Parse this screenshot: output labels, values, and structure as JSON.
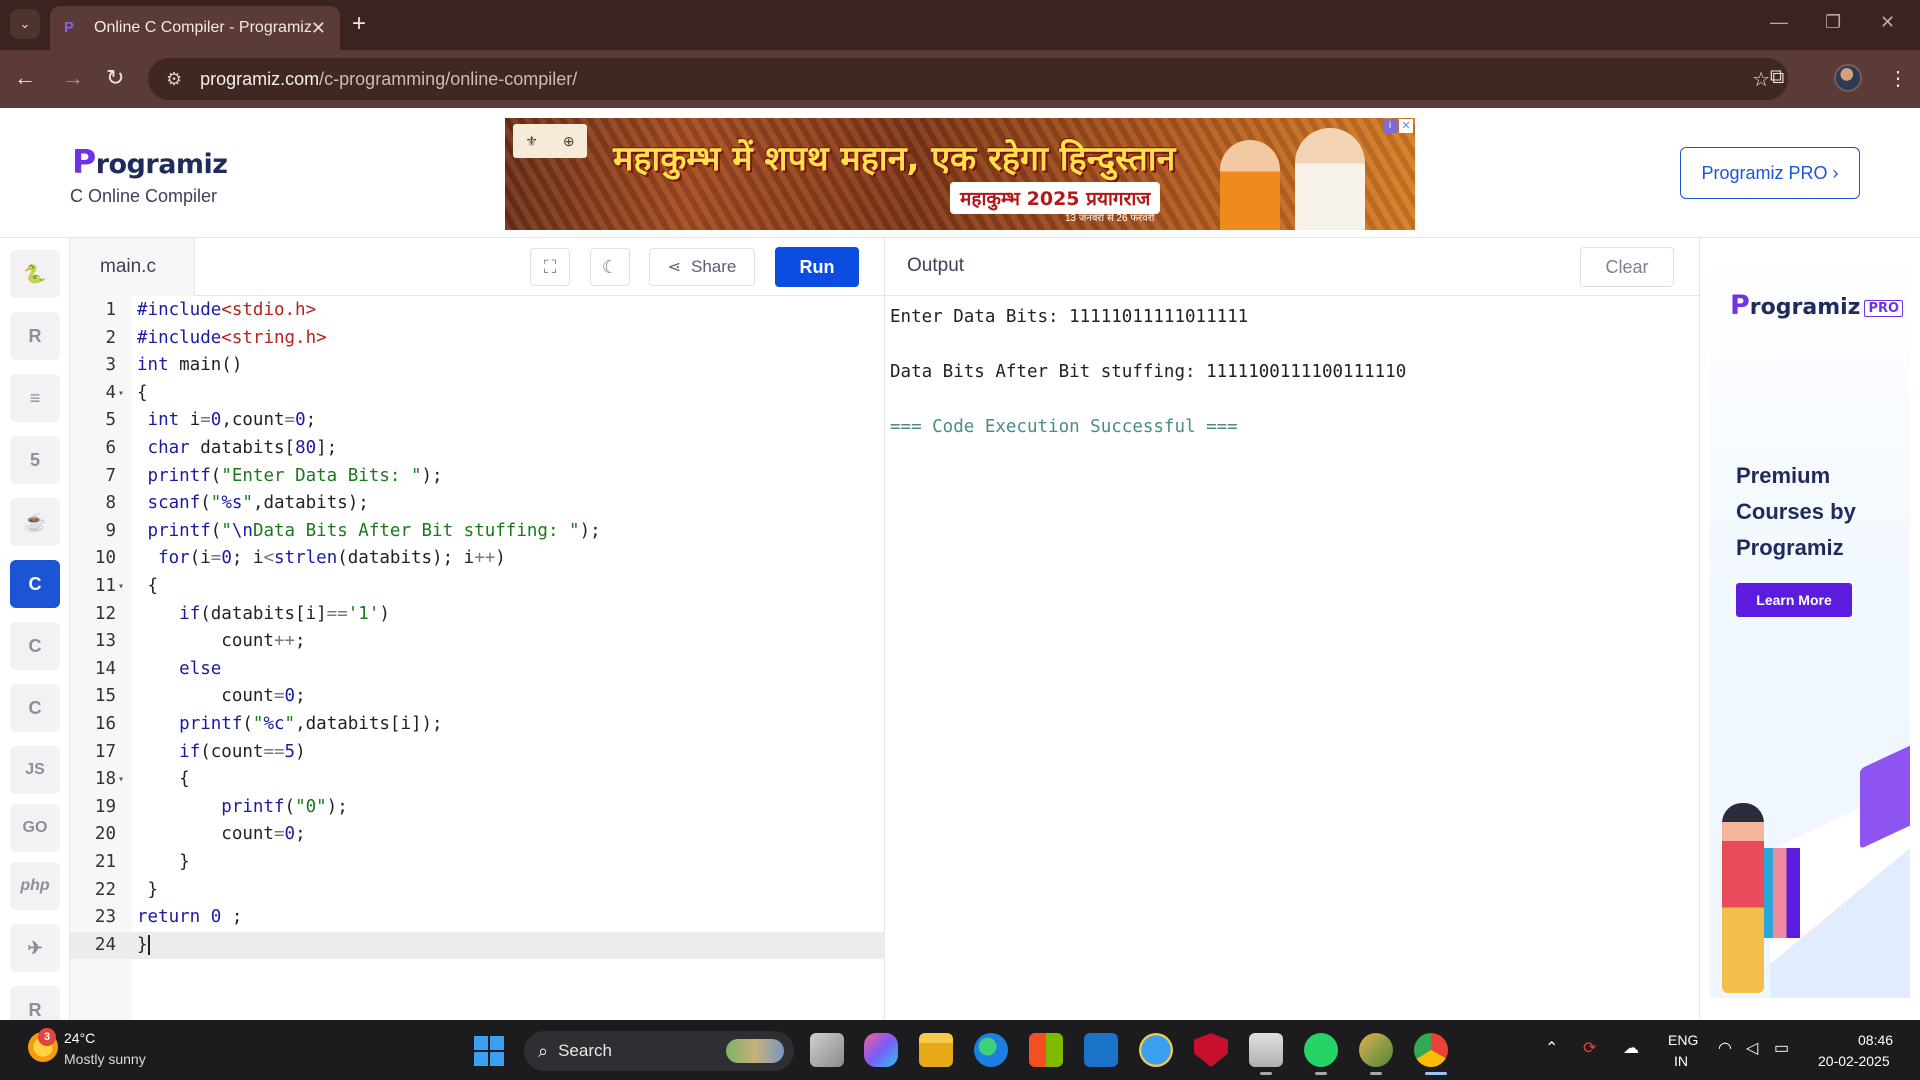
{
  "browser": {
    "tab_title": "Online C Compiler - Programiz",
    "url_main": "programiz.com",
    "url_path": "/c-programming/online-compiler/"
  },
  "header": {
    "logo_p": "P",
    "logo_rest": "rogramiz",
    "subtitle": "C Online Compiler",
    "pro_button": "Programiz PRO ›"
  },
  "ad_banner": {
    "headline": "महाकुम्भ में शपथ महान, एक रहेगा हिन्दुस्तान",
    "subline": "महाकुम्भ 2025 प्रयागराज",
    "dates": "13 जनवरी से 26 फरवरी"
  },
  "languages": [
    {
      "name": "python",
      "glyph": "🐍"
    },
    {
      "name": "r",
      "glyph": "R"
    },
    {
      "name": "sql",
      "glyph": "≡"
    },
    {
      "name": "html",
      "glyph": "5"
    },
    {
      "name": "java",
      "glyph": "☕"
    },
    {
      "name": "c",
      "glyph": "C"
    },
    {
      "name": "cpp",
      "glyph": "C"
    },
    {
      "name": "csharp",
      "glyph": "C"
    },
    {
      "name": "javascript",
      "glyph": "JS"
    },
    {
      "name": "go",
      "glyph": "GO"
    },
    {
      "name": "php",
      "glyph": "php"
    },
    {
      "name": "swift",
      "glyph": "✈"
    },
    {
      "name": "rust",
      "glyph": "R"
    }
  ],
  "editor": {
    "filename": "main.c",
    "share_label": "Share",
    "run_label": "Run",
    "active_line": 24
  },
  "output": {
    "title": "Output",
    "clear_label": "Clear",
    "lines": [
      "Enter Data Bits: 11111011111011111",
      "",
      "Data Bits After Bit stuffing: 1111100111100111110",
      "",
      "=== Code Execution Successful ==="
    ]
  },
  "side_ad": {
    "logo_p": "P",
    "logo_rest": "rogramiz",
    "badge": "PRO",
    "headline": "Premium Courses by Programiz",
    "button": "Learn More"
  },
  "taskbar": {
    "weather_badge": "3",
    "temperature": "24°C",
    "weather": "Mostly sunny",
    "search_placeholder": "Search",
    "lang_top": "ENG",
    "lang_bottom": "IN",
    "time": "08:46",
    "date": "20-02-2025"
  }
}
